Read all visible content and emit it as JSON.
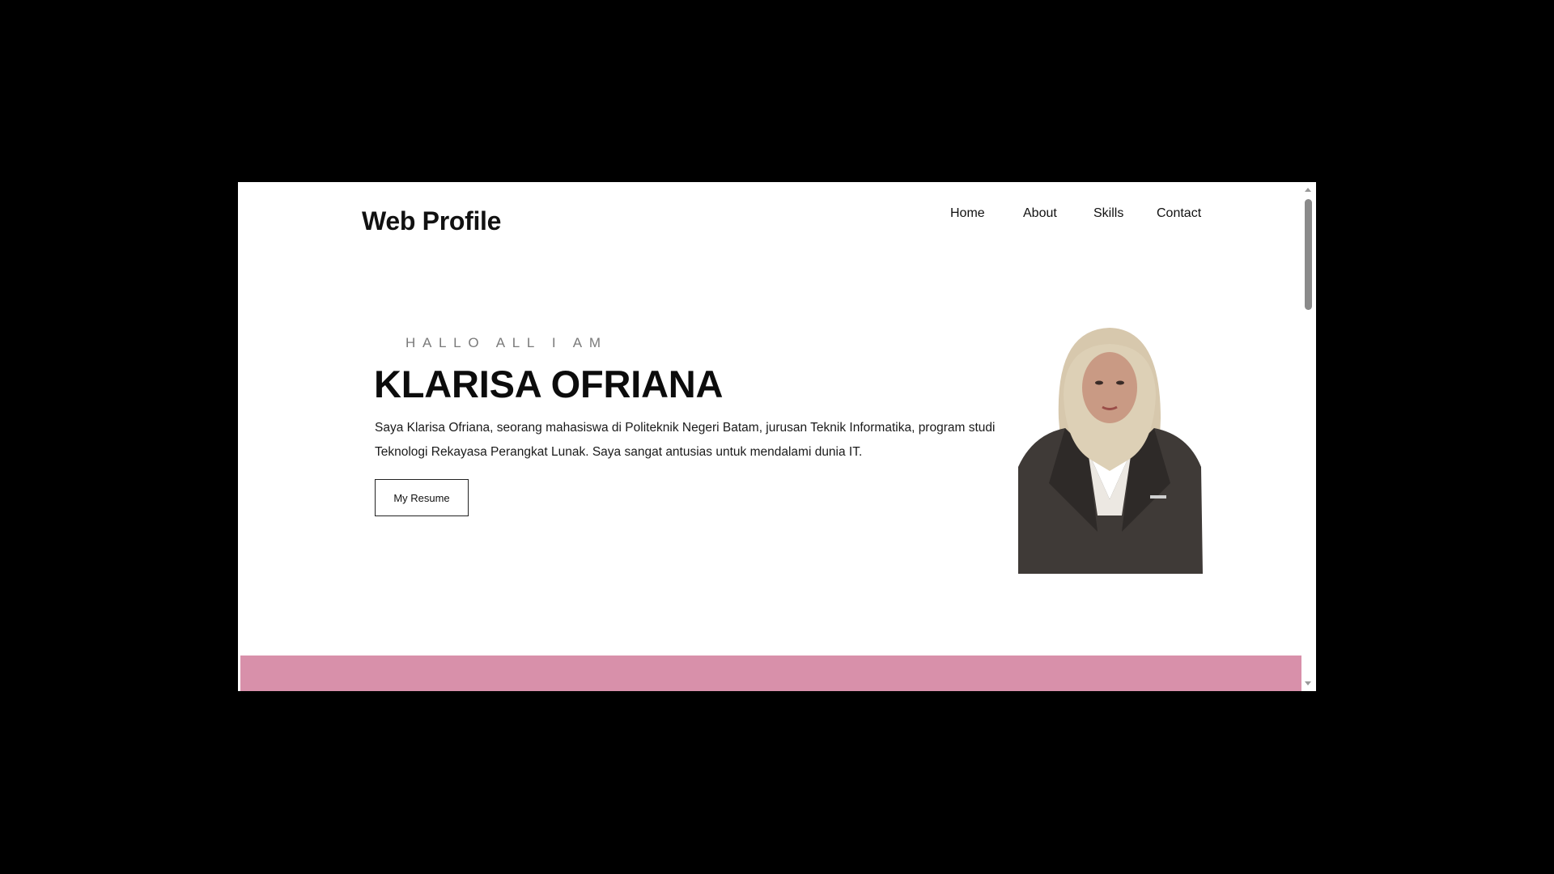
{
  "header": {
    "brand": "Web Profile",
    "nav": {
      "home": "Home",
      "about": "About",
      "skills": "Skills",
      "contact": "Contact"
    }
  },
  "hero": {
    "greeting": "HALLO ALL I AM",
    "name": "KLARISA OFRIANA",
    "description": "Saya Klarisa Ofriana, seorang mahasiswa di Politeknik Negeri Batam, jurusan Teknik Informatika, program studi Teknologi Rekayasa Perangkat Lunak. Saya sangat antusias untuk mendalami dunia IT.",
    "resume_button": "My Resume"
  },
  "colors": {
    "accent_band": "#d890aa",
    "scrollbar_thumb": "#8a8a8a"
  }
}
